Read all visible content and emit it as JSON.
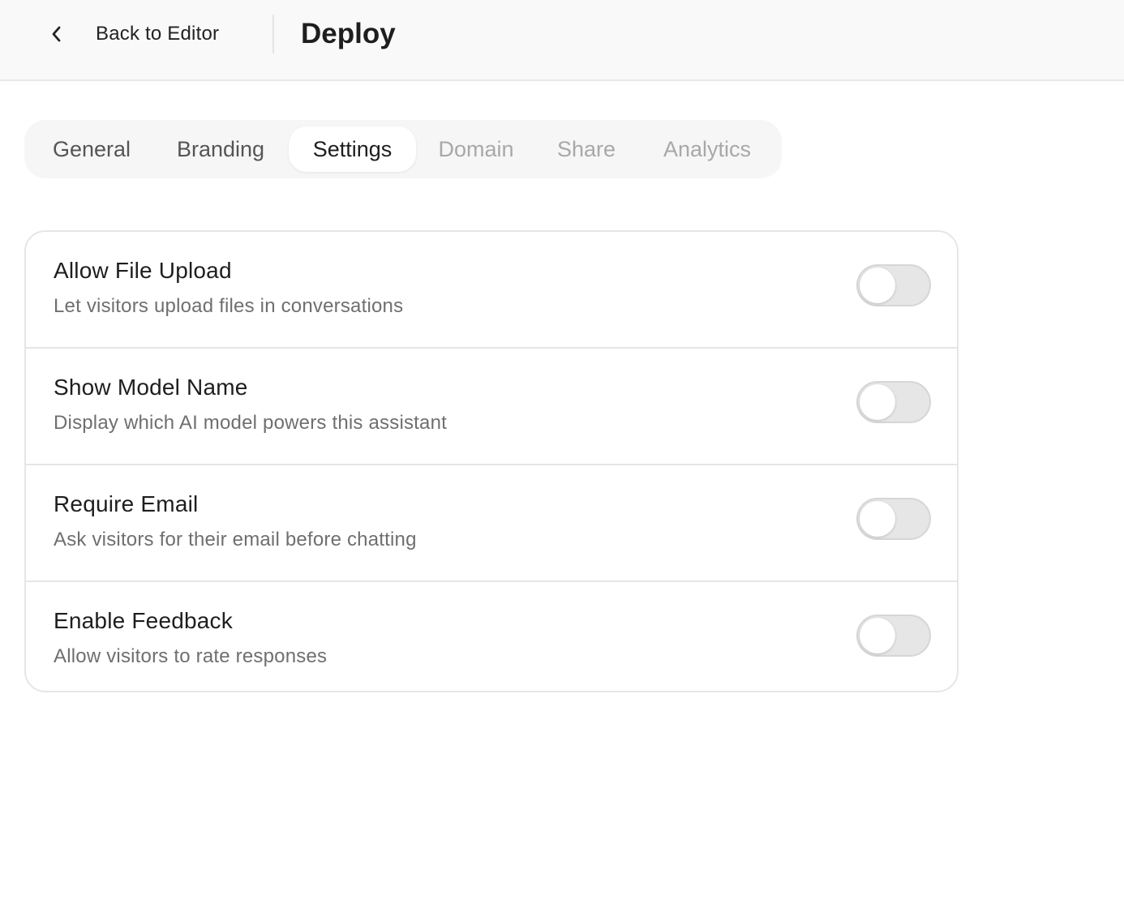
{
  "header": {
    "back_label": "Back to Editor",
    "title": "Deploy",
    "back_icon": "chevron-left-icon"
  },
  "tabs": [
    {
      "label": "General",
      "state": "enabled"
    },
    {
      "label": "Branding",
      "state": "enabled"
    },
    {
      "label": "Settings",
      "state": "active"
    },
    {
      "label": "Domain",
      "state": "disabled"
    },
    {
      "label": "Share",
      "state": "disabled"
    },
    {
      "label": "Analytics",
      "state": "disabled"
    }
  ],
  "settings": [
    {
      "title": "Allow File Upload",
      "description": "Let visitors upload files in conversations",
      "enabled": false
    },
    {
      "title": "Show Model Name",
      "description": "Display which AI model powers this assistant",
      "enabled": false
    },
    {
      "title": "Require Email",
      "description": "Ask visitors for their email before chatting",
      "enabled": false
    },
    {
      "title": "Enable Feedback",
      "description": "Allow visitors to rate responses",
      "enabled": false
    }
  ],
  "colors": {
    "header_bg": "#f9f9f9",
    "toggle_off": "#e6e6e6",
    "text_primary": "#1e1e1e",
    "text_secondary": "#6f6f6f",
    "tab_disabled": "#a8a8a8"
  }
}
